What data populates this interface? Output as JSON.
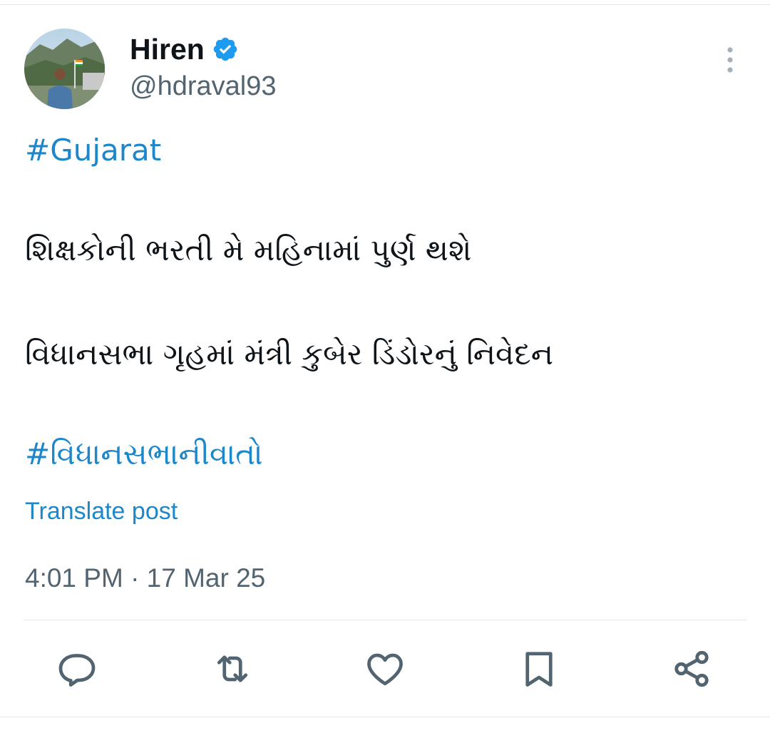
{
  "author": {
    "display_name": "Hiren",
    "handle": "@hdraval93",
    "verified": true
  },
  "tweet": {
    "hashtag_top": "#Gujarat",
    "line_1": "શિક્ષકોની ભરતી મે મહિનામાં પુર્ણ થશે",
    "line_2": "વિધાનસભા ગૃહમાં મંત્રી કુબેર ડિંડોરનું નિવેદન",
    "hashtag_bottom": "#વિધાનસભાનીવાતો"
  },
  "translate_label": "Translate post",
  "timestamp": "4:01 PM · 17 Mar 25",
  "colors": {
    "link": "#1d87c9",
    "verified_badge": "#1d9bf0",
    "text": "#0f1419",
    "secondary": "#536471",
    "icon": "#536471"
  },
  "icons": {
    "verified": "verified-badge-icon",
    "more": "more-vertical-icon",
    "reply": "reply-icon",
    "repost": "repost-icon",
    "like": "heart-icon",
    "bookmark": "bookmark-icon",
    "share": "share-icon"
  }
}
